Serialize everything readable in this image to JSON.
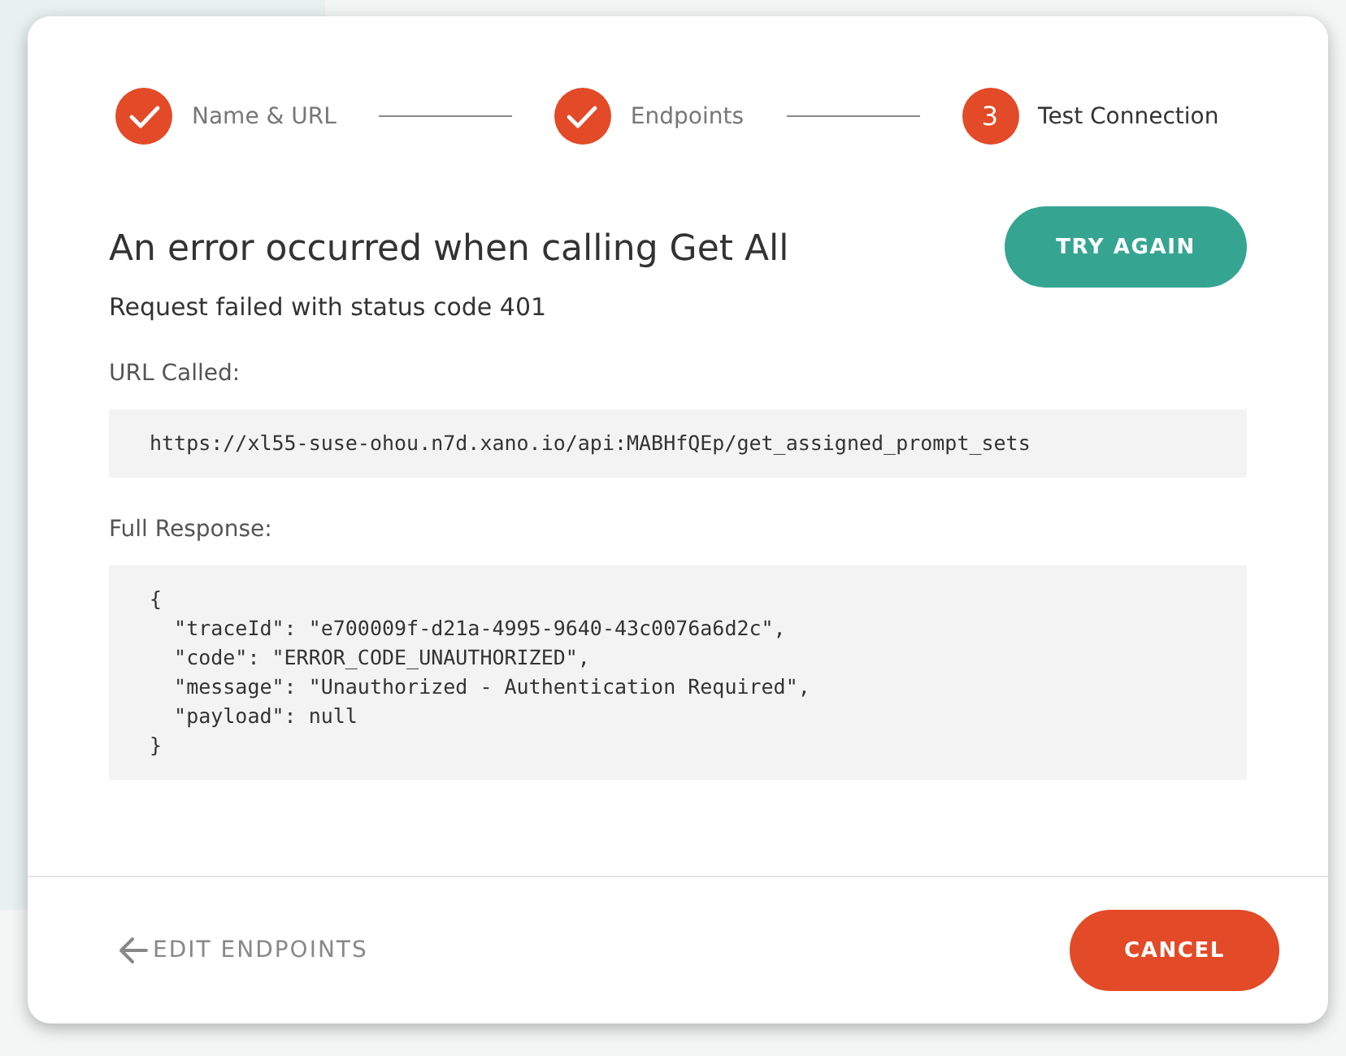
{
  "steps": [
    {
      "label": "Name & URL",
      "completed": true,
      "selected": false
    },
    {
      "label": "Endpoints",
      "completed": true,
      "selected": false
    },
    {
      "label": "Test Connection",
      "completed": false,
      "selected": true,
      "number": "3"
    }
  ],
  "error": {
    "title": "An error occurred when calling Get All",
    "subtitle": "Request failed with status code 401"
  },
  "try_again_button": "TRY AGAIN",
  "url_section": {
    "label": "URL Called:",
    "value": "https://xl55-suse-ohou.n7d.xano.io/api:MABHfQEp/get_assigned_prompt_sets"
  },
  "response_section": {
    "label": "Full Response:",
    "value": "{\n  \"traceId\": \"e700009f-d21a-4995-9640-43c0076a6d2c\",\n  \"code\": \"ERROR_CODE_UNAUTHORIZED\",\n  \"message\": \"Unauthorized - Authentication Required\",\n  \"payload\": null\n}"
  },
  "footer": {
    "back_link": "EDIT ENDPOINTS",
    "cancel_button": "CANCEL"
  }
}
